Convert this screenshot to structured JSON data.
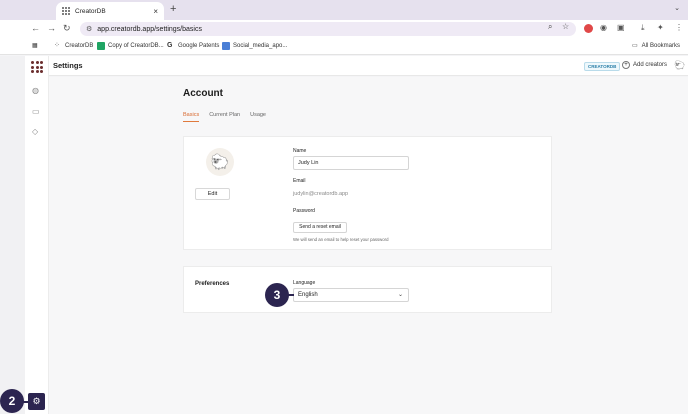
{
  "browser": {
    "tab_title": "CreatorDB",
    "tab_close": "×",
    "new_tab": "+",
    "tab_menu": "⌄",
    "url": "app.creatordb.app/settings/basics",
    "back": "←",
    "forward": "→",
    "reload": "↻",
    "bookmarks": [
      {
        "label": "CreatorDB",
        "icon": "creatordb-grid-icon"
      },
      {
        "label": "Copy of CreatorDB...",
        "icon": "sheets-plus-icon"
      },
      {
        "label": "Google Patents",
        "icon": "google-g-icon"
      },
      {
        "label": "Social_media_apo...",
        "icon": "doc-icon"
      }
    ],
    "all_bookmarks": "All Bookmarks"
  },
  "header": {
    "title": "Settings",
    "badge": "CREATORDB",
    "add_creators": "Add creators"
  },
  "page": {
    "title": "Account",
    "tabs": [
      "Basics",
      "Current Plan",
      "Usage"
    ],
    "active_tab": "Basics"
  },
  "account": {
    "edit_label": "Edit",
    "name_label": "Name",
    "name_value": "Judy Lin",
    "email_label": "Email",
    "email_value": "judylin@creatordb.app",
    "password_label": "Password",
    "reset_button": "Send a reset email",
    "reset_help": "We will send an email to help reset your password"
  },
  "preferences": {
    "title": "Preferences",
    "language_label": "Language",
    "language_value": "English"
  },
  "markers": {
    "step3": "3",
    "step2": "2"
  },
  "colors": {
    "accent": "#e07a3d",
    "marker": "#2c2550",
    "badge": "#2a7fa8"
  }
}
